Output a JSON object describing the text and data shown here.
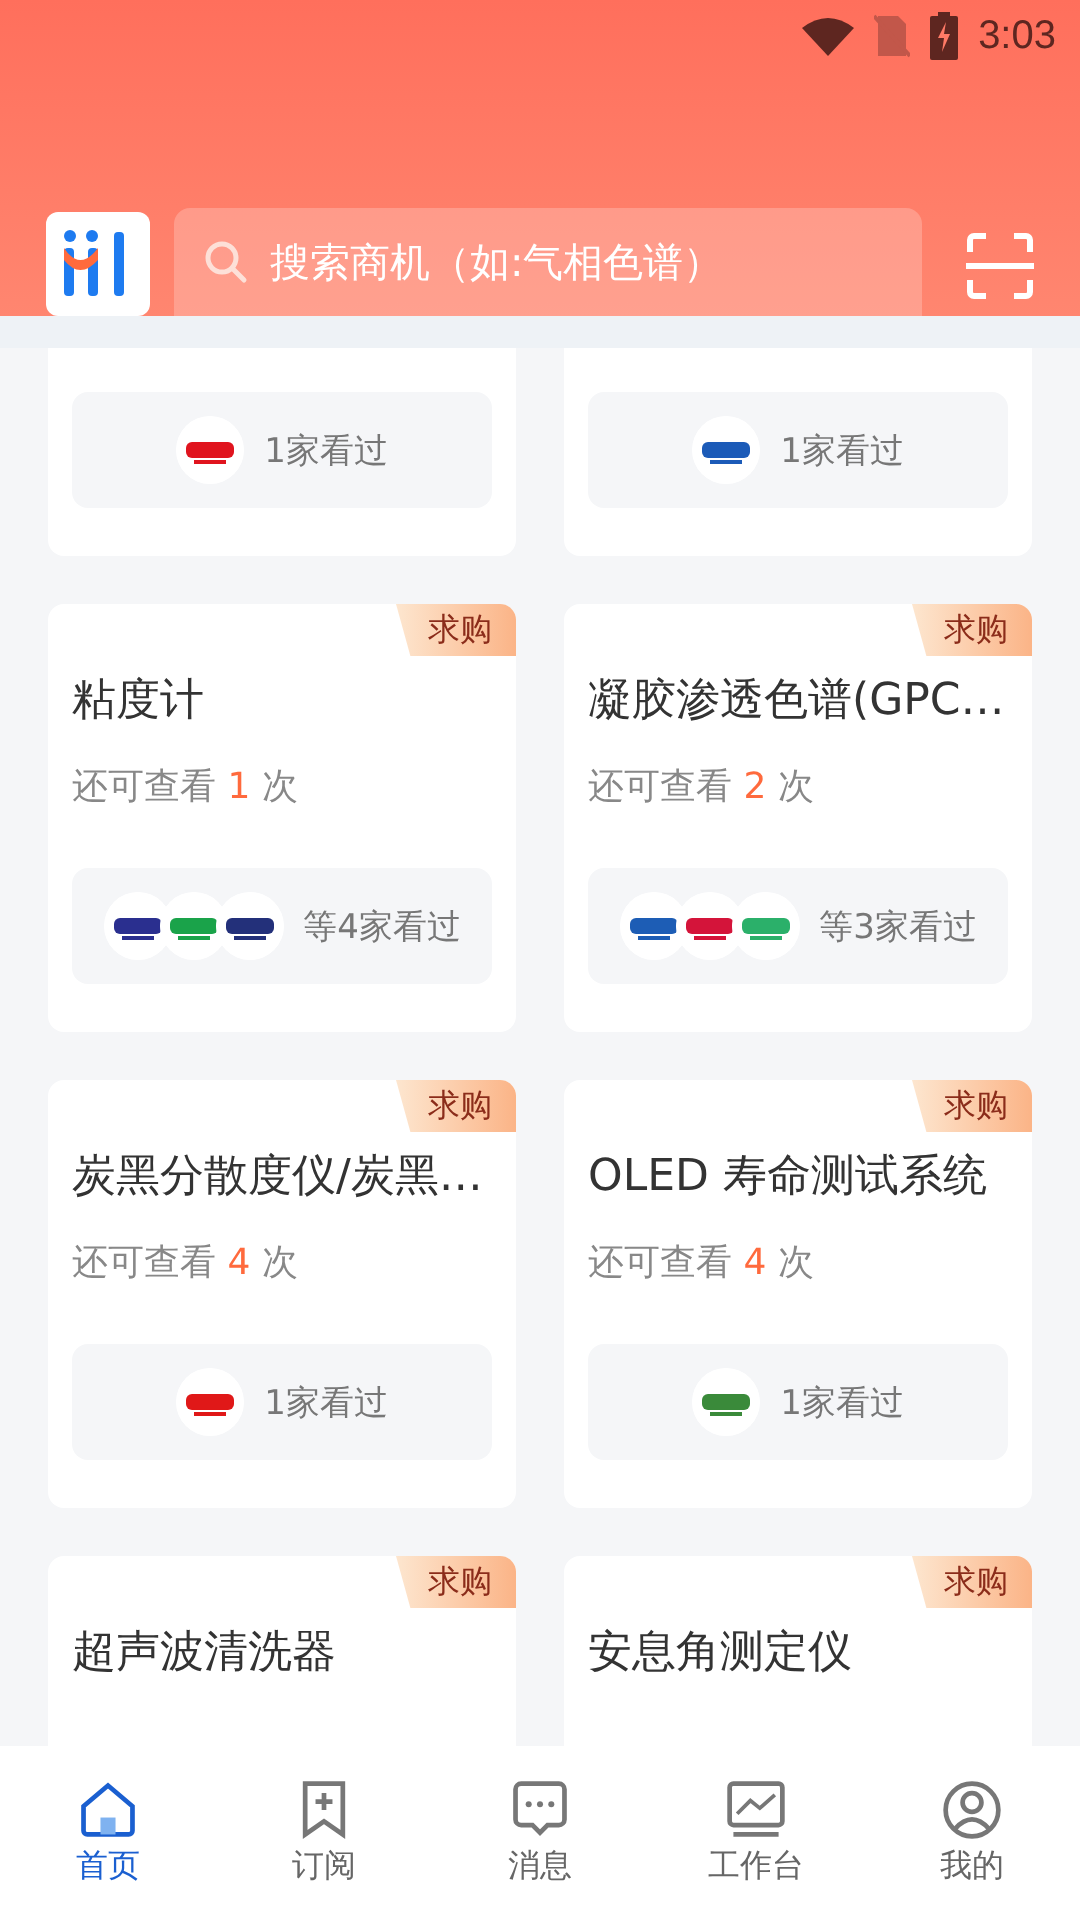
{
  "status_bar": {
    "time": "3:03"
  },
  "search": {
    "placeholder": "搜索商机（如:气相色谱）"
  },
  "cards": [
    {
      "seen": "1家看过",
      "logos": [
        {
          "color": "#e0141e"
        }
      ]
    },
    {
      "seen": "1家看过",
      "logos": [
        {
          "color": "#1c5bb8"
        }
      ]
    },
    {
      "tag": "求购",
      "title": "粘度计",
      "views_label": "还可查看",
      "views_count": "1",
      "views_unit": "次",
      "seen": "等4家看过",
      "logos": [
        {
          "color": "#2a2f8f"
        },
        {
          "color": "#1aa34a"
        },
        {
          "color": "#23307a"
        }
      ]
    },
    {
      "tag": "求购",
      "title": "凝胶渗透色谱(GPC…",
      "views_label": "还可查看",
      "views_count": "2",
      "views_unit": "次",
      "seen": "等3家看过",
      "logos": [
        {
          "color": "#1d5db5"
        },
        {
          "color": "#d4143a"
        },
        {
          "color": "#2bb06a"
        }
      ]
    },
    {
      "tag": "求购",
      "title": "炭黑分散度仪/炭黑…",
      "views_label": "还可查看",
      "views_count": "4",
      "views_unit": "次",
      "seen": "1家看过",
      "logos": [
        {
          "color": "#e01818"
        }
      ]
    },
    {
      "tag": "求购",
      "title": "OLED 寿命测试系统",
      "views_label": "还可查看",
      "views_count": "4",
      "views_unit": "次",
      "seen": "1家看过",
      "logos": [
        {
          "color": "#3a8a3a"
        }
      ]
    },
    {
      "tag": "求购",
      "title": "超声波清洗器"
    },
    {
      "tag": "求购",
      "title": "安息角测定仪"
    }
  ],
  "tab_bar": [
    {
      "label": "首页",
      "kind": "home",
      "selected": true
    },
    {
      "label": "订阅",
      "kind": "bookmark",
      "selected": false
    },
    {
      "label": "消息",
      "kind": "chat",
      "selected": false
    },
    {
      "label": "工作台",
      "kind": "board",
      "selected": false
    },
    {
      "label": "我的",
      "kind": "user",
      "selected": false
    }
  ]
}
